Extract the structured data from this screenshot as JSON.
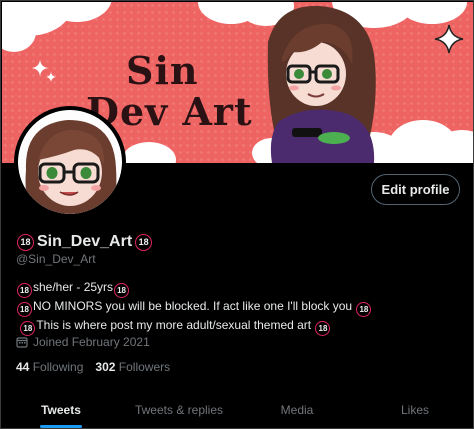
{
  "banner": {
    "title_line1": "Sin",
    "title_line2": "Dev Art",
    "background": "#ee6462"
  },
  "profile": {
    "badge": "18",
    "display_name": "Sin_Dev_Art",
    "handle": "@Sin_Dev_Art",
    "edit_button": "Edit profile",
    "bio": [
      {
        "text": "she/her - 25yrs"
      },
      {
        "text": "NO MINORS you will be blocked. If act like one I'll block you"
      },
      {
        "text": "This is where post my more adult/sexual themed art"
      }
    ],
    "joined": "Joined February 2021",
    "following_count": "44",
    "following_label": "Following",
    "followers_count": "302",
    "followers_label": "Followers"
  },
  "tabs": [
    {
      "label": "Tweets",
      "active": true
    },
    {
      "label": "Tweets & replies",
      "active": false
    },
    {
      "label": "Media",
      "active": false
    },
    {
      "label": "Likes",
      "active": false
    }
  ],
  "colors": {
    "accent": "#1d9bf0",
    "badge_ring": "#e0245e",
    "muted_text": "#71767b"
  },
  "icons": {
    "calendar": "calendar-icon",
    "sparkle": "sparkle-icon"
  }
}
